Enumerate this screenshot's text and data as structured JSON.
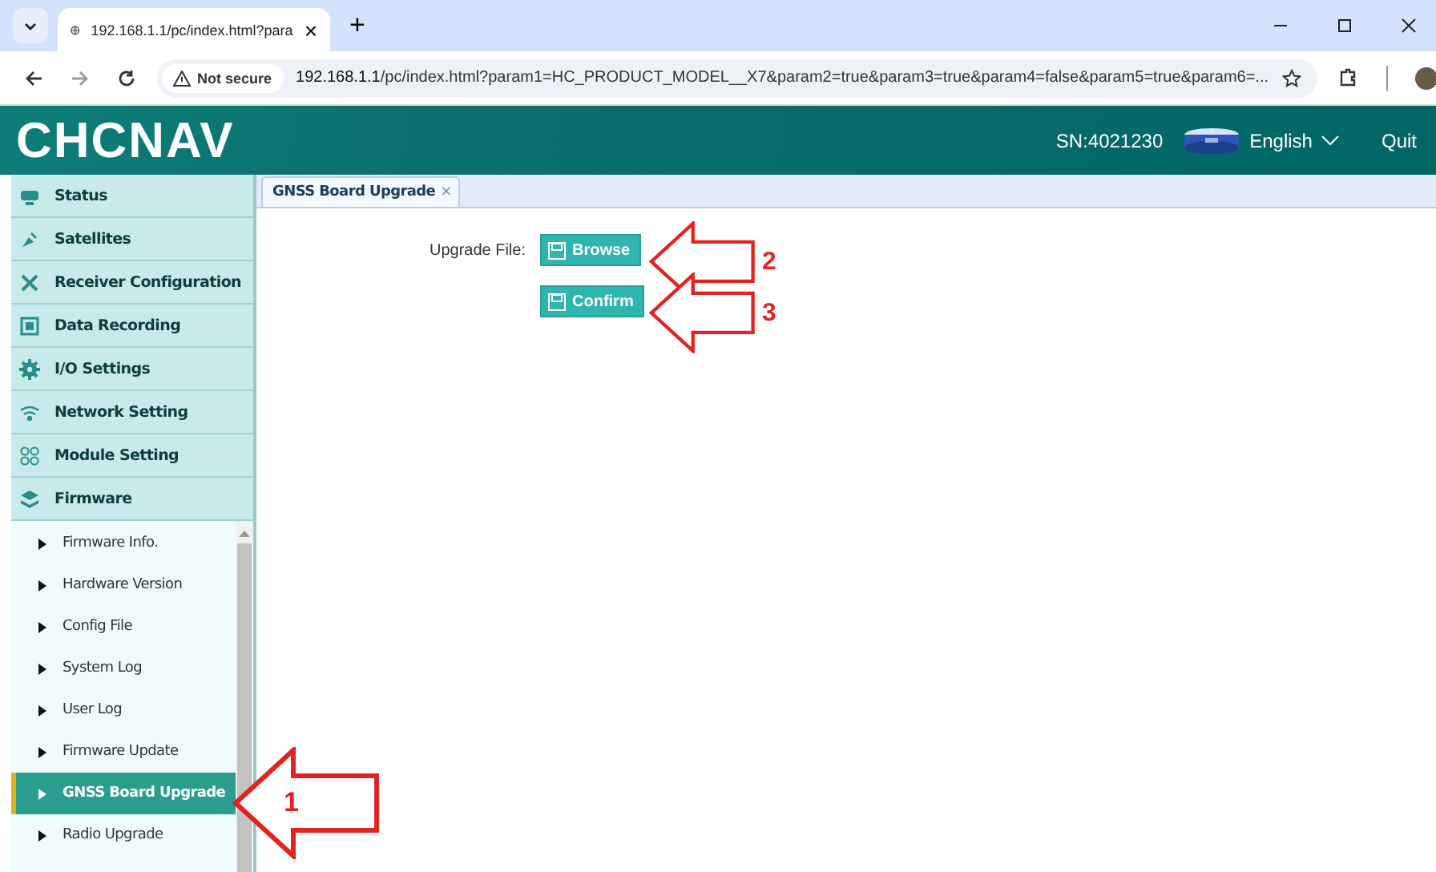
{
  "browser": {
    "tab_title": "192.168.1.1/pc/index.html?para",
    "tab_close": "×",
    "new_tab": "+",
    "security": "Not secure",
    "url_host": "192.168.1.1",
    "url_rest": "/pc/index.html?param1=HC_PRODUCT_MODEL__X7&param2=true&param3=true&param4=false&param5=true&param6=..."
  },
  "header": {
    "logo": "CHCNAV",
    "serial": "SN:4021230",
    "language": "English",
    "quit": "Quit"
  },
  "menu": [
    {
      "label": "Status"
    },
    {
      "label": "Satellites"
    },
    {
      "label": "Receiver Configuration"
    },
    {
      "label": "Data Recording"
    },
    {
      "label": "I/O Settings"
    },
    {
      "label": "Network Setting"
    },
    {
      "label": "Module Setting"
    },
    {
      "label": "Firmware",
      "children": [
        {
          "label": "Firmware Info.",
          "selected": false
        },
        {
          "label": "Hardware Version",
          "selected": false
        },
        {
          "label": "Config File",
          "selected": false
        },
        {
          "label": "System Log",
          "selected": false
        },
        {
          "label": "User Log",
          "selected": false
        },
        {
          "label": "Firmware Update",
          "selected": false
        },
        {
          "label": "GNSS Board Upgrade",
          "selected": true
        },
        {
          "label": "Radio Upgrade",
          "selected": false
        }
      ]
    }
  ],
  "page_tab": {
    "label": "GNSS Board Upgrade",
    "close": "×"
  },
  "form": {
    "label": "Upgrade File:",
    "browse": "Browse",
    "confirm": "Confirm"
  },
  "annotations": [
    "1",
    "2",
    "3"
  ]
}
